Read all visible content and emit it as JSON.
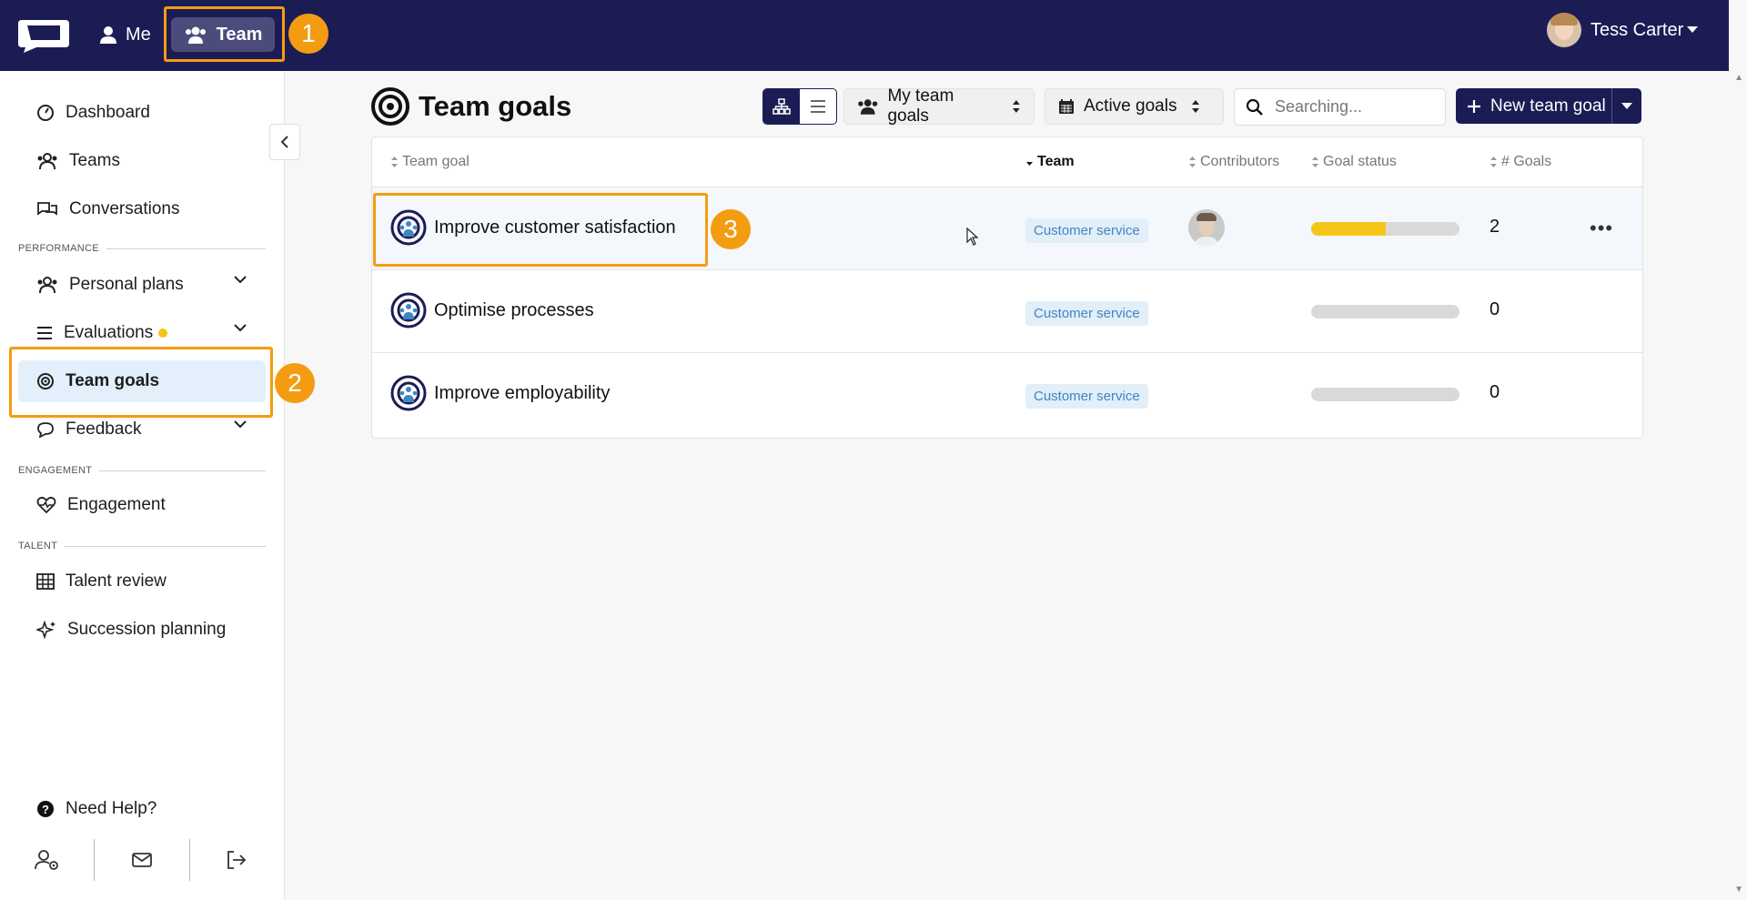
{
  "topbar": {
    "me_label": "Me",
    "team_label": "Team",
    "user_name": "Tess Carter"
  },
  "annotations": [
    "1",
    "2",
    "3"
  ],
  "sidebar": {
    "items": [
      {
        "label": "Dashboard",
        "icon": "gauge-icon"
      },
      {
        "label": "Teams",
        "icon": "users-icon"
      },
      {
        "label": "Conversations",
        "icon": "chat-bubbles-icon"
      },
      {
        "label": "Personal plans",
        "icon": "users-icon"
      },
      {
        "label": "Evaluations",
        "icon": "list-icon"
      },
      {
        "label": "Team goals",
        "icon": "target-icon"
      },
      {
        "label": "Feedback",
        "icon": "chat-bubble-icon"
      },
      {
        "label": "Engagement",
        "icon": "heart-pulse-icon"
      },
      {
        "label": "Talent review",
        "icon": "grid-icon"
      },
      {
        "label": "Succession planning",
        "icon": "sparkles-icon"
      }
    ],
    "sections": [
      "PERFORMANCE",
      "ENGAGEMENT",
      "TALENT"
    ],
    "need_help": "Need Help?"
  },
  "main": {
    "title": "Team goals",
    "filter_team": "My team goals",
    "filter_status": "Active goals",
    "search_placeholder": "Searching...",
    "new_button": "New team goal",
    "columns": [
      "Team goal",
      "Team",
      "Contributors",
      "Goal status",
      "# Goals"
    ],
    "rows": [
      {
        "name": "Improve customer satisfaction",
        "team": "Customer service",
        "progress": 0.5,
        "goals": "2"
      },
      {
        "name": "Optimise processes",
        "team": "Customer service",
        "progress": 0,
        "goals": "0"
      },
      {
        "name": "Improve employability",
        "team": "Customer service",
        "progress": 0,
        "goals": "0"
      }
    ]
  },
  "colors": {
    "topbar": "#1c1c55",
    "accent_orange": "#f39c12",
    "progress_yellow": "#f5c518",
    "tag_blue": "#3f86c5"
  }
}
